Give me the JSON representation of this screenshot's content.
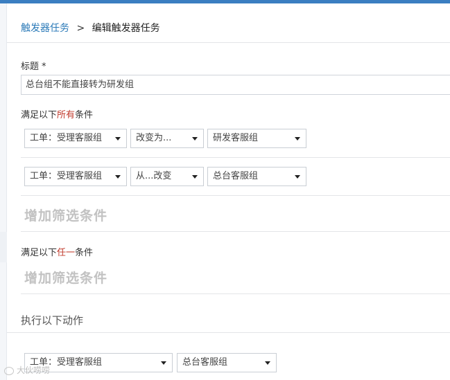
{
  "breadcrumb": {
    "parent": "触发器任务",
    "separator": ">",
    "current": "编辑触发器任务"
  },
  "title_field": {
    "label": "标题",
    "required_mark": "*",
    "value": "总台组不能直接转为研发组"
  },
  "all_conditions": {
    "label_prefix": "满足以下",
    "label_highlight": "所有",
    "label_suffix": "条件",
    "rows": [
      {
        "field": "工单：受理客服组",
        "operator": "改变为...",
        "value": "研发客服组"
      },
      {
        "field": "工单：受理客服组",
        "operator": "从...改变",
        "value": "总台客服组"
      }
    ],
    "add_filter": "增加筛选条件"
  },
  "any_conditions": {
    "label_prefix": "满足以下",
    "label_highlight": "任一",
    "label_suffix": "条件",
    "add_filter": "增加筛选条件"
  },
  "actions": {
    "heading": "执行以下动作",
    "rows": [
      {
        "field": "工单：受理客服组",
        "value": "总台客服组"
      }
    ]
  },
  "watermark": "大伙唠唠",
  "colors": {
    "top_bar": "#3b7ec1",
    "link": "#2b7ab8",
    "highlight": "#c0392b",
    "add_filter_text": "#c2c2c2"
  }
}
